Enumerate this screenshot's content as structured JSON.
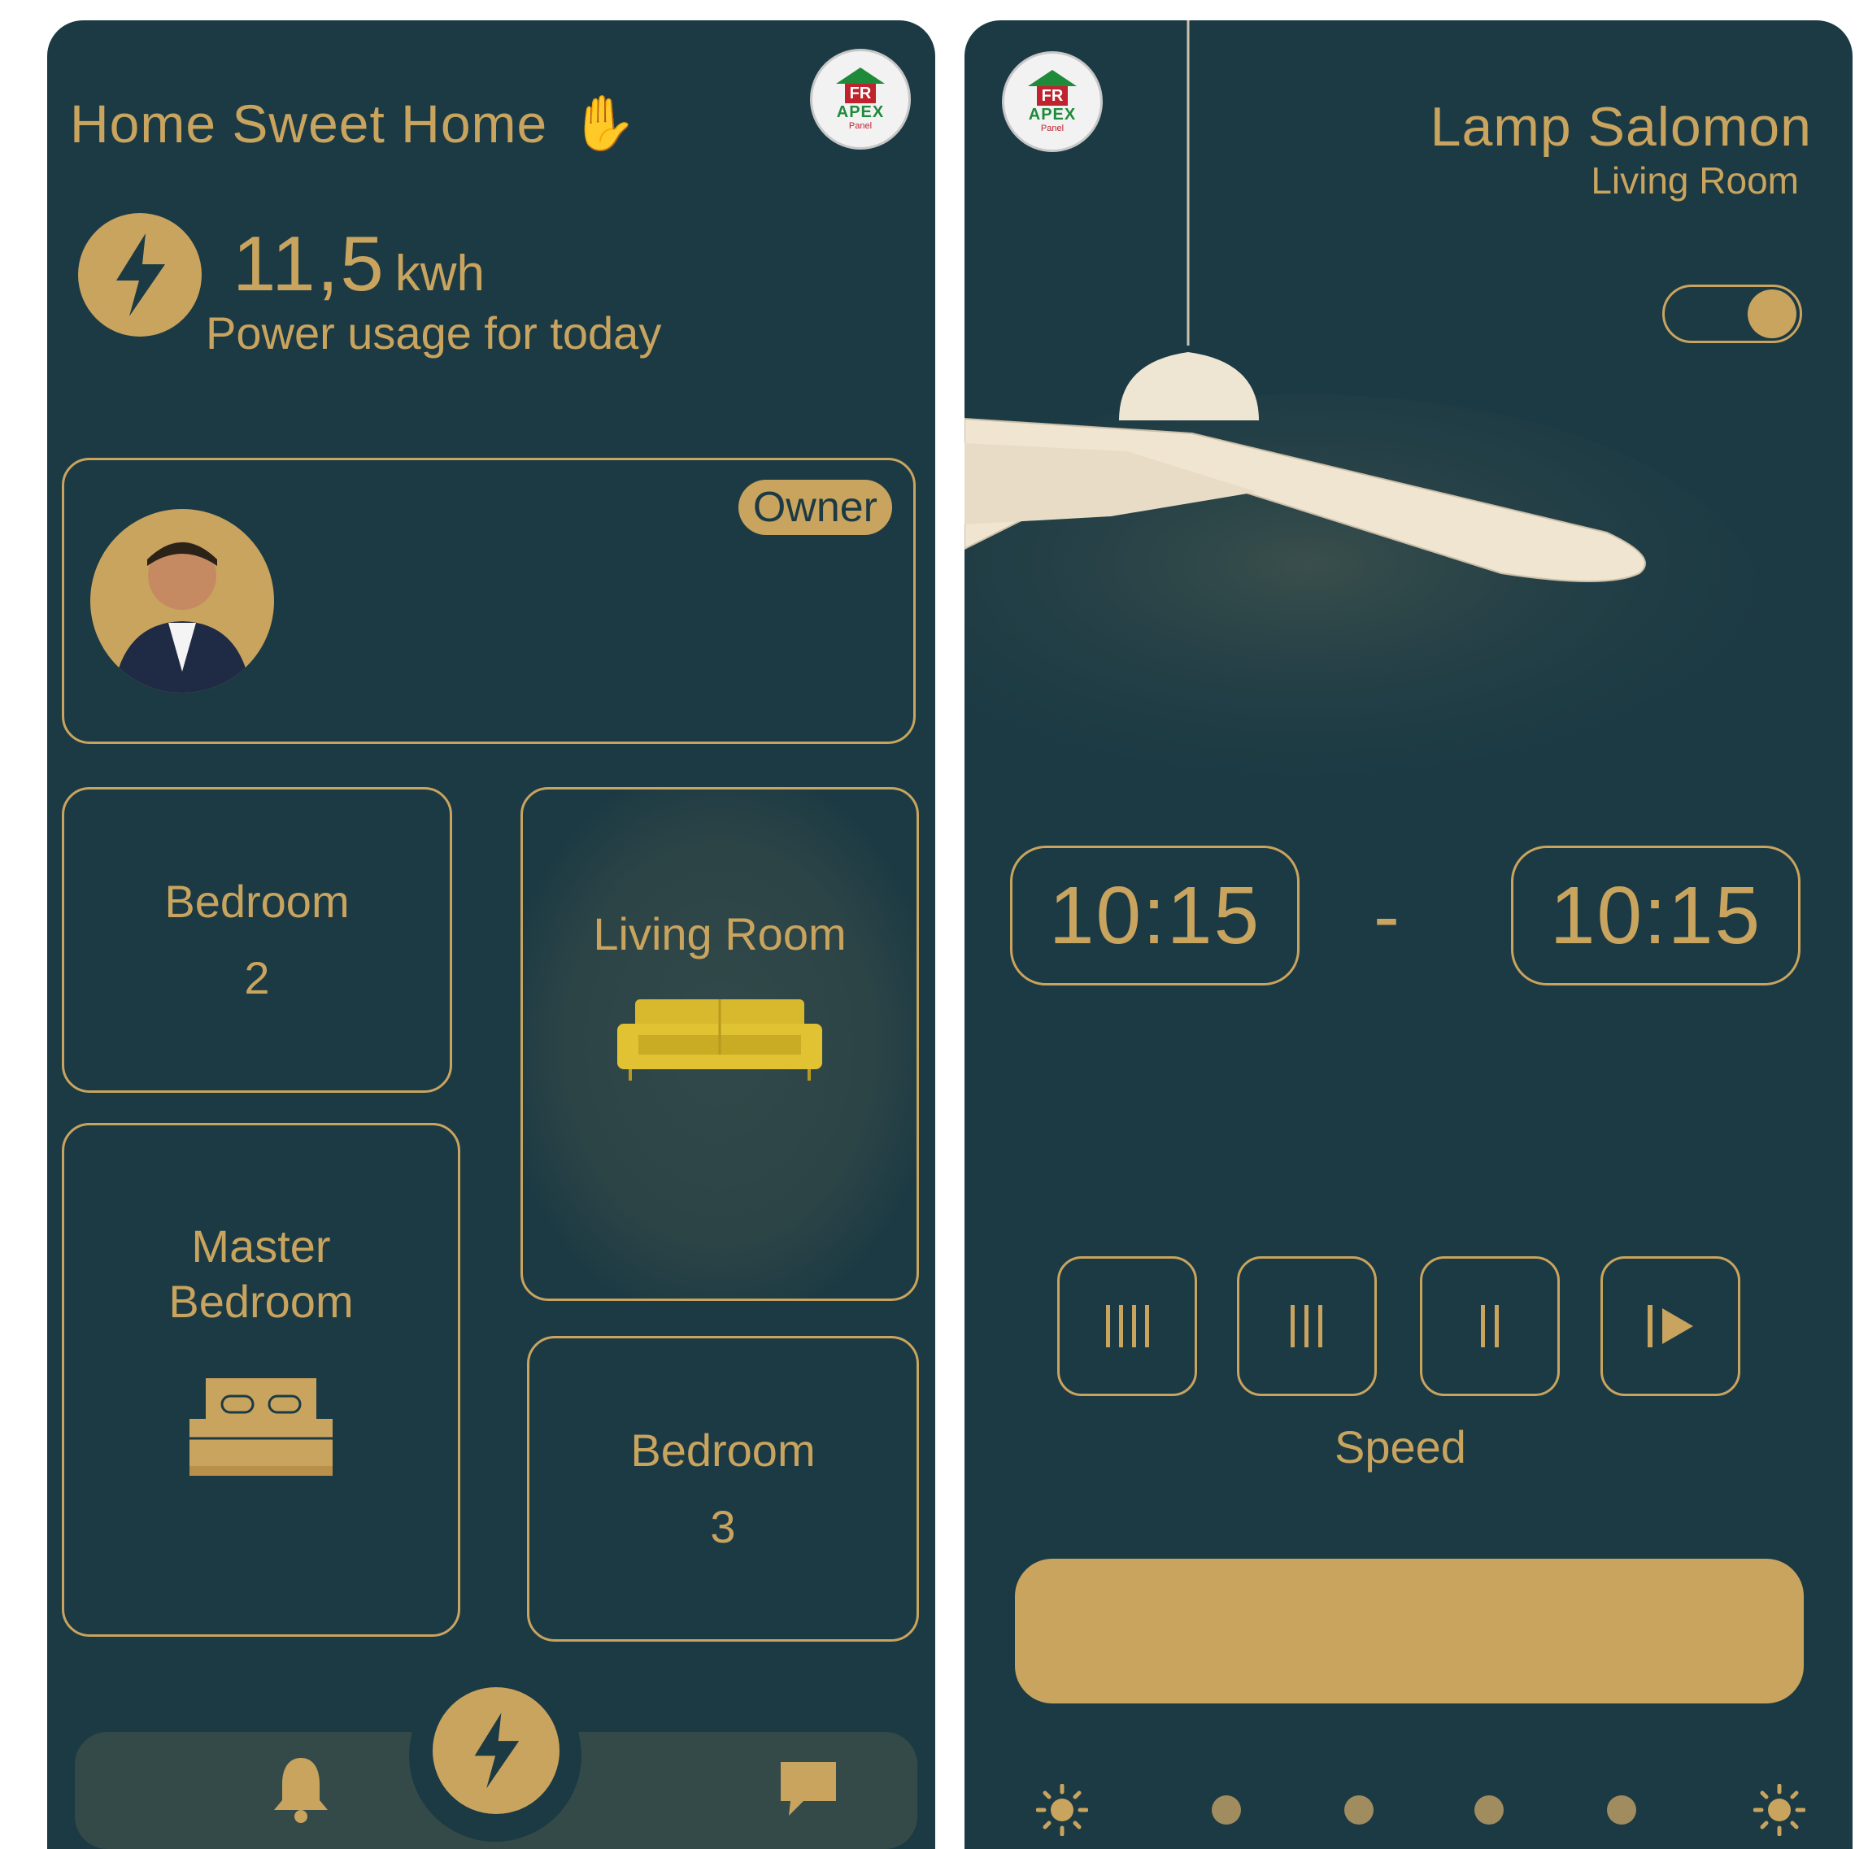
{
  "left_screen": {
    "greeting": "Home Sweet Home",
    "greeting_emoji": "✋",
    "logo": {
      "line1": "FR",
      "line2": "APEX",
      "line3": "Panel"
    },
    "power": {
      "value": "11,5",
      "unit": "kwh",
      "caption": "Power usage for today"
    },
    "profile": {
      "badge": "Owner"
    },
    "rooms": {
      "bedroom2": {
        "name": "Bedroom",
        "number": "2"
      },
      "living": {
        "name": "Living Room"
      },
      "master": {
        "line1": "Master",
        "line2": "Bedroom"
      },
      "bedroom3": {
        "name": "Bedroom",
        "number": "3"
      }
    },
    "nav": [
      "bell-icon",
      "lightning-icon",
      "chat-icon"
    ]
  },
  "right_screen": {
    "logo": {
      "line1": "FR",
      "line2": "APEX",
      "line3": "Panel"
    },
    "device_name": "Lamp Salomon",
    "device_room": "Living Room",
    "power_toggle_on": true,
    "time_start": "10:15",
    "time_separator": "-",
    "time_end": "10:15",
    "speed_label": "Speed",
    "speed_buttons": [
      "speed-4-icon",
      "speed-3-icon",
      "speed-2-icon",
      "speed-1-icon"
    ],
    "brightness_steps": 6
  },
  "colors": {
    "background": "#1c3a44",
    "accent": "#c9a45e"
  }
}
